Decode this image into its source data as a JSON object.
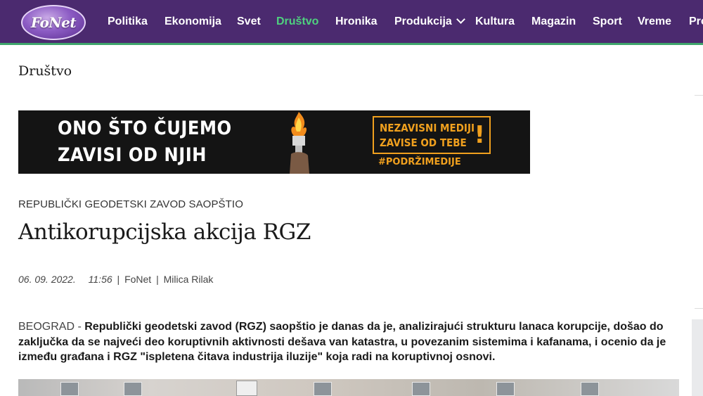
{
  "site": {
    "logo_text": "FoNet",
    "brand_color": "#4b2a6f",
    "accent_color": "#3fa56b"
  },
  "nav": {
    "items": [
      {
        "label": "Politika",
        "active": false
      },
      {
        "label": "Ekonomija",
        "active": false
      },
      {
        "label": "Svet",
        "active": false
      },
      {
        "label": "Društvo",
        "active": true
      },
      {
        "label": "Hronika",
        "active": false
      },
      {
        "label": "Produkcija",
        "active": false,
        "has_dropdown": true
      },
      {
        "label": "Kultura",
        "active": false
      },
      {
        "label": "Magazin",
        "active": false
      },
      {
        "label": "Sport",
        "active": false
      },
      {
        "label": "Vreme",
        "active": false
      },
      {
        "label": "Pro",
        "active": false
      }
    ]
  },
  "section": {
    "title": "Društvo"
  },
  "banner": {
    "line1": "ONO ŠTO ČUJEMO",
    "line2": "ZAVISI OD NJIH",
    "box_line1": "NEZAVISNI MEDIJI",
    "box_line2": "ZAVISE OD TEBE",
    "box_exclamation": "!",
    "hashtag": "#PODRŽIMEDIJE",
    "accent_color": "#f0a01e"
  },
  "article": {
    "kicker": "REPUBLIČKI GEODETSKI ZAVOD SAOPŠTIO",
    "headline": "Antikorupcijska akcija RGZ",
    "date": "06. 09. 2022.",
    "time": "11:56",
    "source": "FoNet",
    "author": "Milica Rilak",
    "dateline": "BEOGRAD - ",
    "lead": "Republički geodetski zavod (RGZ) saopštio je danas da je, analizirajući strukturu lanaca korupcije, došao do zaključka da se najveći deo koruptivnih aktivnosti dešava van katastra, u povezanim sistemima i kafanama, i ocenio da je između građana i RGZ \"ispletena čitava industrija iluzije\" koja radi na koruptivnoj osnovi."
  }
}
